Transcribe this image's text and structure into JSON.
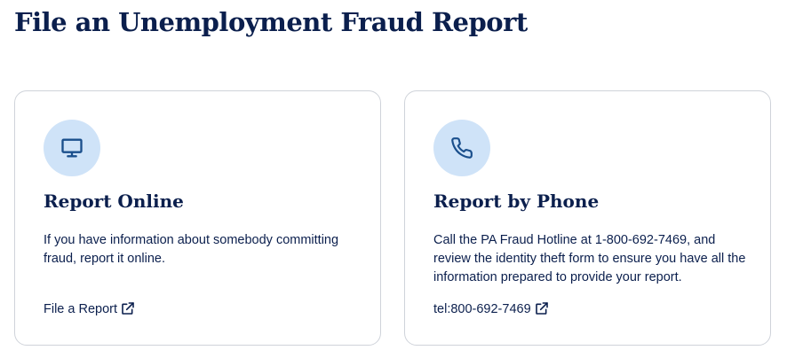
{
  "page": {
    "title": "File an Unemployment Fraud Report"
  },
  "cards": {
    "online": {
      "icon": "monitor-icon",
      "title": "Report Online",
      "text": "If you have information about somebody committing fraud, report it online.",
      "link_label": "File a Report",
      "link_icon": "external-link-icon"
    },
    "phone": {
      "icon": "phone-icon",
      "title": "Report by Phone",
      "text": "Call the PA Fraud Hotline at 1-800-692-7469, and review the identity theft form to ensure you have all the information prepared to provide your report.",
      "link_label": "tel:800-692-7469",
      "link_icon": "external-link-icon"
    }
  },
  "colors": {
    "heading": "#0b1f4d",
    "icon_bg": "#cfe3f8",
    "icon_stroke": "#1a4f8c",
    "card_border": "#cfd3da"
  }
}
